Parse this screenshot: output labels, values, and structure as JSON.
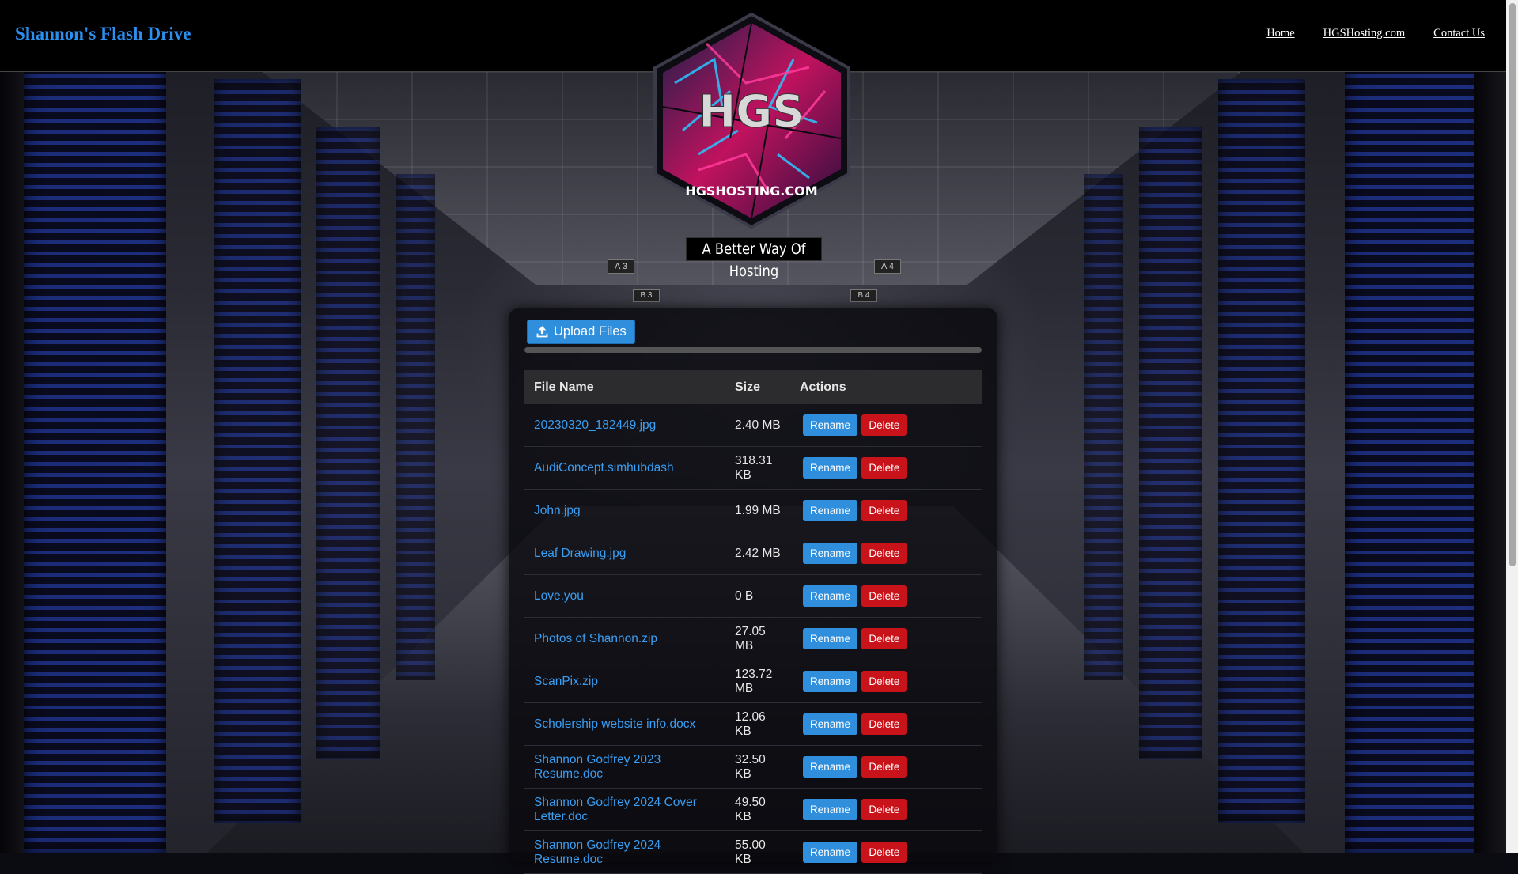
{
  "header": {
    "site_title": "Shannon's Flash Drive",
    "nav": [
      "Home",
      "HGSHosting.com",
      "Contact Us"
    ]
  },
  "logo": {
    "text": "HGS",
    "subtext": "HGSHOSTING.COM",
    "tagline": "A Better Way Of Hosting"
  },
  "background_signs": [
    "A 3",
    "B 3",
    "A 4",
    "B 4"
  ],
  "upload": {
    "label": "Upload Files",
    "progress": 0
  },
  "table": {
    "headers": [
      "File Name",
      "Size",
      "Actions"
    ],
    "rename_label": "Rename",
    "delete_label": "Delete",
    "rows": [
      {
        "name": "20230320_182449.jpg",
        "size": "2.40 MB"
      },
      {
        "name": "AudiConcept.simhubdash",
        "size": "318.31 KB"
      },
      {
        "name": "John.jpg",
        "size": "1.99 MB"
      },
      {
        "name": "Leaf Drawing.jpg",
        "size": "2.42 MB"
      },
      {
        "name": "Love.you",
        "size": "0 B"
      },
      {
        "name": "Photos of Shannon.zip",
        "size": "27.05 MB"
      },
      {
        "name": "ScanPix.zip",
        "size": "123.72 MB"
      },
      {
        "name": "Scholership website info.docx",
        "size": "12.06 KB"
      },
      {
        "name": "Shannon Godfrey 2023 Resume.doc",
        "size": "32.50 KB"
      },
      {
        "name": "Shannon Godfrey 2024 Cover Letter.doc",
        "size": "49.50 KB"
      },
      {
        "name": "Shannon Godfrey 2024 Resume.doc",
        "size": "55.00 KB"
      }
    ]
  },
  "colors": {
    "accent": "#2f8fdd",
    "danger": "#c9131a",
    "title": "#2a8ff0",
    "link": "#3a9ef2"
  }
}
